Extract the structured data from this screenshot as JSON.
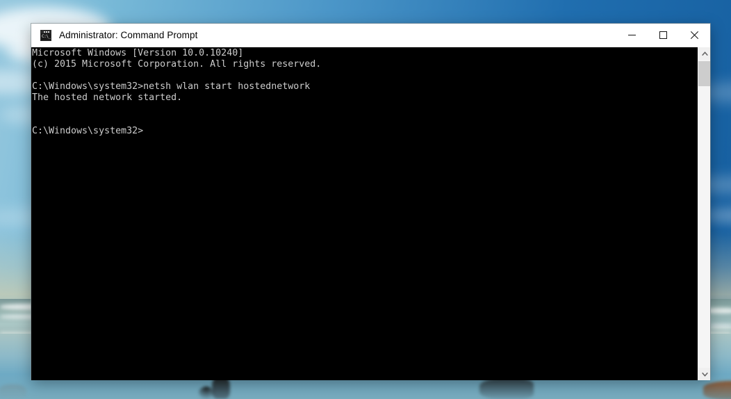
{
  "window": {
    "title": "Administrator: Command Prompt",
    "icon": "command-prompt-icon",
    "icon_glyph": "C:\\_",
    "controls": {
      "minimize_label": "Minimize",
      "maximize_label": "Maximize",
      "close_label": "Close"
    }
  },
  "console": {
    "prompt_path": "C:\\Windows\\system32>",
    "command": "netsh wlan start hostednetwork",
    "result": "The hosted network started.",
    "text": "Microsoft Windows [Version 10.0.10240]\n(c) 2015 Microsoft Corporation. All rights reserved.\n\nC:\\Windows\\system32>netsh wlan start hostednetwork\nThe hosted network started.\n\n\nC:\\Windows\\system32>",
    "lines": [
      "Microsoft Windows [Version 10.0.10240]",
      "(c) 2015 Microsoft Corporation. All rights reserved.",
      "",
      "C:\\Windows\\system32>netsh wlan start hostednetwork",
      "The hosted network started.",
      "",
      "",
      "C:\\Windows\\system32>"
    ],
    "foreground_color": "#cccccc",
    "background_color": "#000000"
  },
  "scrollbar": {
    "up_label": "Scroll up",
    "down_label": "Scroll down",
    "thumb_label": "Scroll thumb"
  },
  "desktop": {
    "wallpaper_description": "beach and ocean under blue sky"
  }
}
